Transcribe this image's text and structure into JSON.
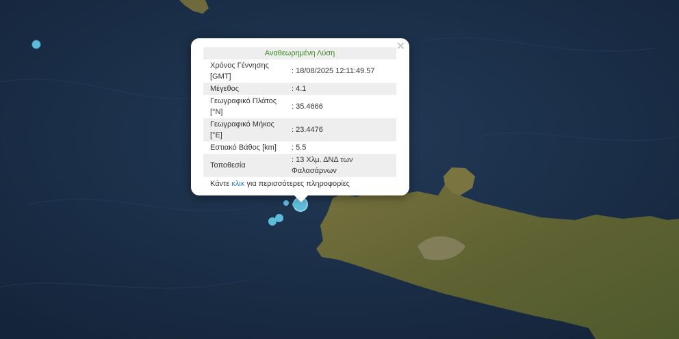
{
  "colors": {
    "sea": "#1b2d45",
    "land": "#6b6b3d",
    "quake_marker": "#5fbcd9",
    "title_green": "#3a8a1f",
    "link_blue": "#2a7fb8"
  },
  "popup": {
    "close_icon": "×",
    "title": "Αναθεωρημένη Λύση",
    "rows": [
      {
        "label": "Χρόνος Γέννησης [GMT]",
        "value": ": 18/08/2025 12:11:49.57"
      },
      {
        "label": "Μέγεθος",
        "value": ": 4.1"
      },
      {
        "label": "Γεωγραφικό Πλάτος [°N]",
        "value": ": 35.4666"
      },
      {
        "label": "Γεωγραφικό Μήκος [°E]",
        "value": ": 23.4476"
      },
      {
        "label": "Εστιακό Βάθος [km]",
        "value": ": 5.5"
      },
      {
        "label": "Τοποθεσία",
        "value": ": 13 Χλμ. ΔΝΔ των Φαλασάρνων"
      }
    ],
    "more_prefix": "Κάντε ",
    "more_link": "κλικ",
    "more_suffix": " για περισσότερες πληροφορίες"
  }
}
